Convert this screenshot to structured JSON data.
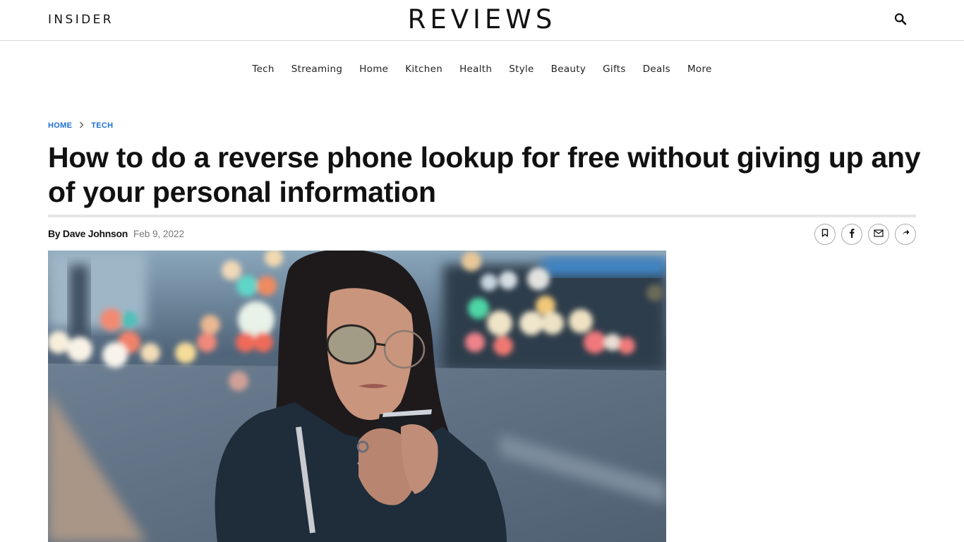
{
  "header": {
    "brand_left": "INSIDER",
    "brand_center": "REVIEWS",
    "search_icon": "search-icon"
  },
  "nav": {
    "items": [
      "Tech",
      "Streaming",
      "Home",
      "Kitchen",
      "Health",
      "Style",
      "Beauty",
      "Gifts",
      "Deals",
      "More"
    ]
  },
  "breadcrumb": {
    "items": [
      "HOME",
      "TECH"
    ],
    "separator_icon": "chevron-right-icon"
  },
  "article": {
    "title": "How to do a reverse phone lookup for free without giving up any of your personal information",
    "author": "By Dave Johnson",
    "date": "Feb 9, 2022",
    "share_icons": [
      "bookmark-icon",
      "facebook-icon",
      "email-icon",
      "share-icon"
    ],
    "hero_image_alt": "Woman with glasses looking at her smartphone on a city street at night with blurred lights"
  },
  "colors": {
    "link_blue": "#1d6fd6",
    "text": "#111111",
    "muted": "#777777",
    "divider": "#e6e6e6"
  }
}
